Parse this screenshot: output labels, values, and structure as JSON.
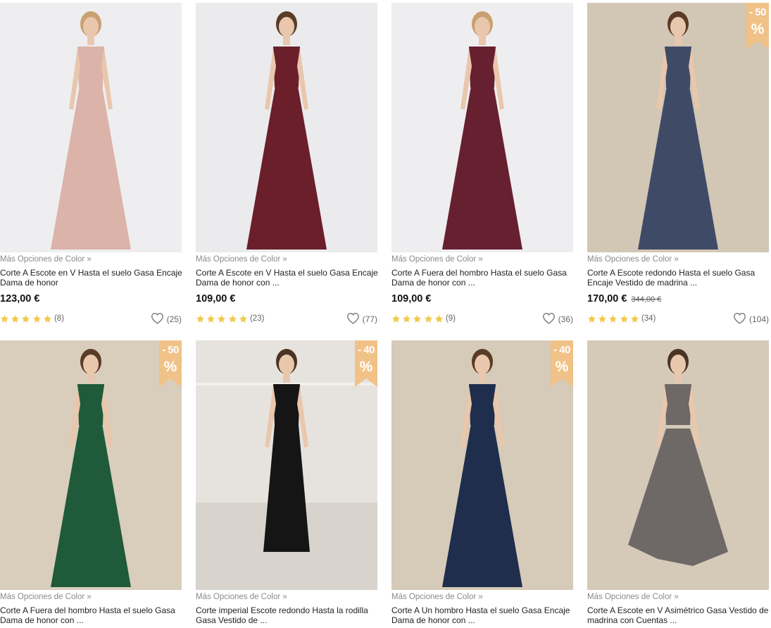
{
  "colors": {
    "star": "#f2c94c",
    "badge": "#f1c287",
    "text": "#222222",
    "muted": "#8a8a8a"
  },
  "icons": {
    "star": "star-icon",
    "heart": "heart-icon",
    "discount": "discount-badge"
  },
  "products": [
    {
      "more_colors": "Más Opciones de Color »",
      "title": "Corte A Escote en V Hasta el suelo Gasa Encaje Dama de honor",
      "price": "123,00 €",
      "old_price": "",
      "rating": 5,
      "reviews": "(8)",
      "likes": "(25)",
      "discount": "",
      "bg": "#eeeef0",
      "dress": "#dcb3a8"
    },
    {
      "more_colors": "Más Opciones de Color »",
      "title": "Corte A Escote en V Hasta el suelo Gasa Encaje Dama de honor con ...",
      "price": "109,00 €",
      "old_price": "",
      "rating": 5,
      "reviews": "(23)",
      "likes": "(77)",
      "discount": "",
      "bg": "#ebebed",
      "dress": "#6a1f2b"
    },
    {
      "more_colors": "Más Opciones de Color »",
      "title": "Corte A Fuera del hombro Hasta el suelo Gasa Dama de honor con ...",
      "price": "109,00 €",
      "old_price": "",
      "rating": 5,
      "reviews": "(9)",
      "likes": "(36)",
      "discount": "",
      "bg": "#eeeef0",
      "dress": "#672030"
    },
    {
      "more_colors": "Más Opciones de Color »",
      "title": "Corte A Escote redondo Hasta el suelo Gasa Encaje Vestido de madrina ...",
      "price": "170,00 €",
      "old_price": "344,00 €",
      "rating": 5,
      "reviews": "(34)",
      "likes": "(104)",
      "discount": "- 50",
      "bg": "#d2c6b5",
      "dress": "#3f4b66"
    },
    {
      "more_colors": "Más Opciones de Color »",
      "title": "Corte A Fuera del hombro Hasta el suelo Gasa Dama de honor con ...",
      "price": "",
      "old_price": "",
      "rating": 0,
      "reviews": "",
      "likes": "",
      "discount": "- 50",
      "bg": "#d9cdbc",
      "dress": "#1f5a3a"
    },
    {
      "more_colors": "Más Opciones de Color »",
      "title": "Corte imperial Escote redondo Hasta la rodilla Gasa Vestido de ...",
      "price": "",
      "old_price": "",
      "rating": 0,
      "reviews": "",
      "likes": "",
      "discount": "- 40",
      "bg": "#e6e3df",
      "dress": "#151515"
    },
    {
      "more_colors": "Más Opciones de Color »",
      "title": "Corte A Un hombro Hasta el suelo Gasa Encaje Dama de honor con ...",
      "price": "",
      "old_price": "",
      "rating": 0,
      "reviews": "",
      "likes": "",
      "discount": "- 40",
      "bg": "#d6cab8",
      "dress": "#1e2e4c"
    },
    {
      "more_colors": "Más Opciones de Color »",
      "title": "Corte A Escote en V Asimétrico Gasa Vestido de madrina con Cuentas ...",
      "price": "",
      "old_price": "",
      "rating": 0,
      "reviews": "",
      "likes": "",
      "discount": "",
      "bg": "#d5c9b8",
      "dress": "#6e6866"
    }
  ]
}
